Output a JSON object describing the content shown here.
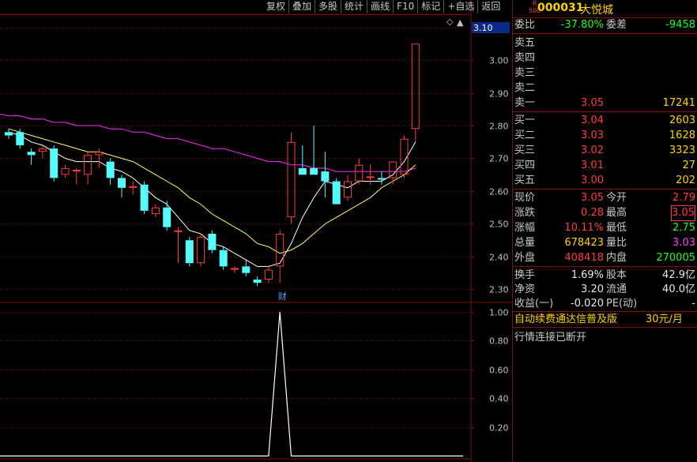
{
  "toolbar": [
    {
      "label": "复权"
    },
    {
      "label": "叠加"
    },
    {
      "label": "多股"
    },
    {
      "label": "统计"
    },
    {
      "label": "画线"
    },
    {
      "label": "F10"
    },
    {
      "label": "标记"
    },
    {
      "label": "+自选"
    },
    {
      "label": "返回"
    }
  ],
  "stock": {
    "market_top": "R",
    "market_bottom": "500",
    "code": "000031",
    "name": "大悦城"
  },
  "quote": {
    "weibi_label": "委比",
    "weibi": "-37.80%",
    "weicha_label": "委差",
    "weicha": "-9458",
    "sell": [
      {
        "label": "卖五",
        "price": "",
        "vol": ""
      },
      {
        "label": "卖四",
        "price": "",
        "vol": ""
      },
      {
        "label": "卖三",
        "price": "",
        "vol": ""
      },
      {
        "label": "卖二",
        "price": "",
        "vol": ""
      },
      {
        "label": "卖一",
        "price": "3.05",
        "vol": "17241"
      }
    ],
    "buy": [
      {
        "label": "买一",
        "price": "3.04",
        "vol": "2603"
      },
      {
        "label": "买二",
        "price": "3.03",
        "vol": "1628"
      },
      {
        "label": "买三",
        "price": "3.02",
        "vol": "3323"
      },
      {
        "label": "买四",
        "price": "3.01",
        "vol": "27"
      },
      {
        "label": "买五",
        "price": "3.00",
        "vol": "202"
      }
    ],
    "stats": [
      {
        "l1": "现价",
        "v1": "3.05",
        "c1": "red",
        "l2": "今开",
        "v2": "2.79",
        "c2": "red",
        "box": false
      },
      {
        "l1": "涨跌",
        "v1": "0.28",
        "c1": "red",
        "l2": "最高",
        "v2": "3.05",
        "c2": "red",
        "box": true
      },
      {
        "l1": "涨幅",
        "v1": "10.11%",
        "c1": "red",
        "l2": "最低",
        "v2": "2.75",
        "c2": "green",
        "box": false
      },
      {
        "l1": "总量",
        "v1": "678423",
        "c1": "yellow",
        "l2": "量比",
        "v2": "3.03",
        "c2": "magenta",
        "box": false
      },
      {
        "l1": "外盘",
        "v1": "408418",
        "c1": "red",
        "l2": "内盘",
        "v2": "270005",
        "c2": "green",
        "box": false
      }
    ],
    "fund": [
      {
        "l1": "换手",
        "v1": "1.69%",
        "l2": "股本",
        "v2": "42.9亿"
      },
      {
        "l1": "净资",
        "v1": "3.20",
        "l2": "流通",
        "v2": "40.0亿"
      },
      {
        "l1": "收益(一)",
        "v1": "-0.020",
        "l2": "PE(动)",
        "v2": "-"
      }
    ],
    "ad_text": "自动续费通达信普及版",
    "ad_price": "30元/月",
    "status": "行情连接已断开"
  },
  "colors": {
    "up": "#ff3c3c",
    "down": "#54fcfc",
    "ma_white": "#ffffff",
    "ma_yellow": "#ffff55",
    "ma_magenta": "#ff28ff",
    "grid": "#7a1010"
  },
  "chart_data": {
    "type": "candlestick",
    "price_axis": {
      "ticks": [
        2.3,
        2.4,
        2.5,
        2.6,
        2.7,
        2.8,
        2.9,
        3.0,
        3.1
      ],
      "ylim": [
        2.26,
        3.14
      ],
      "current_marker": "3.10"
    },
    "candles": [
      {
        "o": 2.78,
        "h": 2.79,
        "l": 2.76,
        "c": 2.77
      },
      {
        "o": 2.78,
        "h": 2.79,
        "l": 2.73,
        "c": 2.74
      },
      {
        "o": 2.72,
        "h": 2.73,
        "l": 2.68,
        "c": 2.71
      },
      {
        "o": 2.72,
        "h": 2.74,
        "l": 2.7,
        "c": 2.73
      },
      {
        "o": 2.73,
        "h": 2.74,
        "l": 2.63,
        "c": 2.64
      },
      {
        "o": 2.65,
        "h": 2.68,
        "l": 2.64,
        "c": 2.67
      },
      {
        "o": 2.66,
        "h": 2.67,
        "l": 2.62,
        "c": 2.665
      },
      {
        "o": 2.65,
        "h": 2.72,
        "l": 2.62,
        "c": 2.71
      },
      {
        "o": 2.71,
        "h": 2.73,
        "l": 2.67,
        "c": 2.72
      },
      {
        "o": 2.69,
        "h": 2.7,
        "l": 2.62,
        "c": 2.64
      },
      {
        "o": 2.64,
        "h": 2.65,
        "l": 2.58,
        "c": 2.61
      },
      {
        "o": 2.61,
        "h": 2.63,
        "l": 2.59,
        "c": 2.615
      },
      {
        "o": 2.62,
        "h": 2.63,
        "l": 2.53,
        "c": 2.54
      },
      {
        "o": 2.53,
        "h": 2.56,
        "l": 2.52,
        "c": 2.55
      },
      {
        "o": 2.55,
        "h": 2.57,
        "l": 2.48,
        "c": 2.49
      },
      {
        "o": 2.48,
        "h": 2.49,
        "l": 2.38,
        "c": 2.48
      },
      {
        "o": 2.45,
        "h": 2.46,
        "l": 2.37,
        "c": 2.38
      },
      {
        "o": 2.38,
        "h": 2.47,
        "l": 2.37,
        "c": 2.46
      },
      {
        "o": 2.47,
        "h": 2.48,
        "l": 2.41,
        "c": 2.42
      },
      {
        "o": 2.42,
        "h": 2.43,
        "l": 2.36,
        "c": 2.37
      },
      {
        "o": 2.36,
        "h": 2.37,
        "l": 2.35,
        "c": 2.365
      },
      {
        "o": 2.37,
        "h": 2.39,
        "l": 2.34,
        "c": 2.35
      },
      {
        "o": 2.33,
        "h": 2.34,
        "l": 2.31,
        "c": 2.32
      },
      {
        "o": 2.33,
        "h": 2.37,
        "l": 2.32,
        "c": 2.36
      },
      {
        "o": 2.37,
        "h": 2.48,
        "l": 2.32,
        "c": 2.47
      },
      {
        "o": 2.52,
        "h": 2.78,
        "l": 2.5,
        "c": 2.75
      },
      {
        "o": 2.67,
        "h": 2.74,
        "l": 2.65,
        "c": 2.65
      },
      {
        "o": 2.67,
        "h": 2.8,
        "l": 2.65,
        "c": 2.65
      },
      {
        "o": 2.66,
        "h": 2.72,
        "l": 2.58,
        "c": 2.63
      },
      {
        "o": 2.63,
        "h": 2.64,
        "l": 2.56,
        "c": 2.56
      },
      {
        "o": 2.58,
        "h": 2.65,
        "l": 2.57,
        "c": 2.63
      },
      {
        "o": 2.63,
        "h": 2.7,
        "l": 2.62,
        "c": 2.68
      },
      {
        "o": 2.64,
        "h": 2.68,
        "l": 2.62,
        "c": 2.645
      },
      {
        "o": 2.64,
        "h": 2.66,
        "l": 2.62,
        "c": 2.635
      },
      {
        "o": 2.64,
        "h": 2.69,
        "l": 2.62,
        "c": 2.69
      },
      {
        "o": 2.65,
        "h": 2.77,
        "l": 2.64,
        "c": 2.76
      },
      {
        "o": 2.79,
        "h": 3.05,
        "l": 2.75,
        "c": 3.05
      }
    ],
    "ma_short": [
      2.78,
      2.77,
      2.75,
      2.74,
      2.72,
      2.7,
      2.69,
      2.69,
      2.69,
      2.67,
      2.66,
      2.64,
      2.61,
      2.58,
      2.56,
      2.52,
      2.48,
      2.47,
      2.44,
      2.43,
      2.41,
      2.39,
      2.37,
      2.37,
      2.38,
      2.44,
      2.52,
      2.58,
      2.63,
      2.62,
      2.61,
      2.63,
      2.63,
      2.63,
      2.65,
      2.69,
      2.75
    ],
    "ma_mid": [
      2.79,
      2.78,
      2.77,
      2.76,
      2.75,
      2.74,
      2.73,
      2.72,
      2.72,
      2.71,
      2.7,
      2.69,
      2.67,
      2.65,
      2.63,
      2.61,
      2.58,
      2.56,
      2.53,
      2.51,
      2.49,
      2.47,
      2.44,
      2.43,
      2.41,
      2.42,
      2.44,
      2.47,
      2.5,
      2.52,
      2.54,
      2.56,
      2.58,
      2.61,
      2.63,
      2.65,
      2.68
    ],
    "ma_long": [
      2.83,
      2.83,
      2.82,
      2.82,
      2.81,
      2.81,
      2.8,
      2.8,
      2.8,
      2.79,
      2.79,
      2.78,
      2.78,
      2.77,
      2.76,
      2.76,
      2.75,
      2.74,
      2.73,
      2.73,
      2.72,
      2.71,
      2.7,
      2.69,
      2.69,
      2.68,
      2.68,
      2.67,
      2.67,
      2.66,
      2.66,
      2.66,
      2.66,
      2.66,
      2.66,
      2.66,
      2.67
    ],
    "event_marker": {
      "index": 24,
      "label": "财"
    },
    "indicator": {
      "ticks": [
        0.2,
        0.4,
        0.6,
        0.8,
        1.0
      ],
      "ylim": [
        -0.02,
        1.06
      ],
      "values": [
        0,
        0,
        0,
        0,
        0,
        0,
        0,
        0,
        0,
        0,
        0,
        0,
        0,
        0,
        0,
        0,
        0,
        0,
        0,
        0,
        0,
        0,
        0,
        0,
        1,
        0,
        0,
        0,
        0,
        0,
        0,
        0,
        0,
        0,
        0,
        0,
        0
      ]
    }
  }
}
